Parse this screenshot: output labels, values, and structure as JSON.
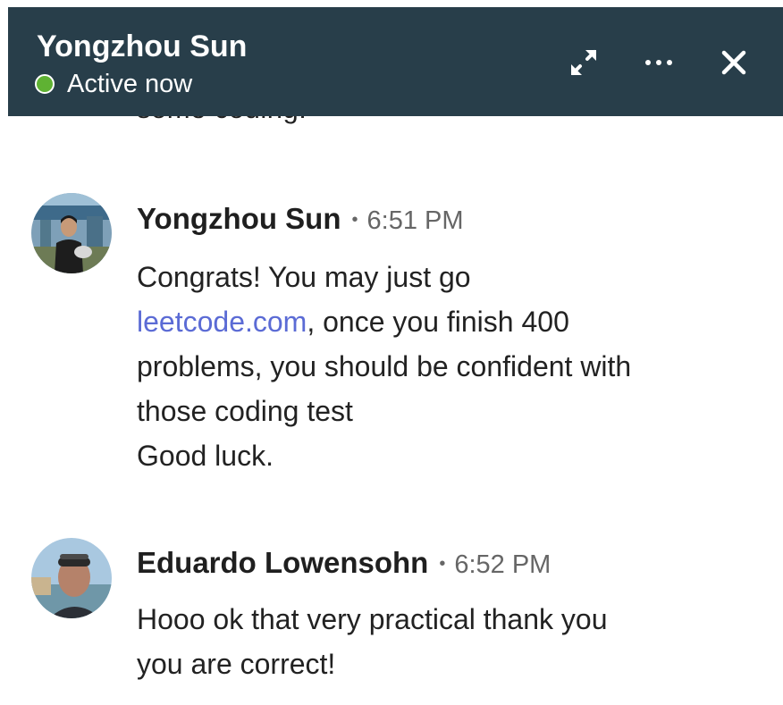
{
  "header": {
    "contact_name": "Yongzhou Sun",
    "status": "Active now",
    "status_color": "#5fb233",
    "background_color": "#283e4a",
    "actions": [
      {
        "icon": "expand-icon"
      },
      {
        "icon": "more-icon"
      },
      {
        "icon": "close-icon"
      }
    ]
  },
  "previous_message_fragment": "some coding!",
  "messages": [
    {
      "sender": "Yongzhou Sun",
      "separator": "•",
      "time": "6:51 PM",
      "line1": "Congrats! You may just go",
      "link_text": "leetcode.com",
      "line2_rest": ", once you finish 400",
      "line3": "problems, you should be confident with",
      "line4": "those coding test",
      "line5": "Good luck."
    },
    {
      "sender": "Eduardo Lowensohn",
      "separator": "•",
      "time": "6:52 PM",
      "line1": "Hooo ok that very practical thank you",
      "line2": "you are correct!"
    }
  ],
  "colors": {
    "link": "#5b6bd5",
    "text": "#222222",
    "meta": "#666666"
  }
}
